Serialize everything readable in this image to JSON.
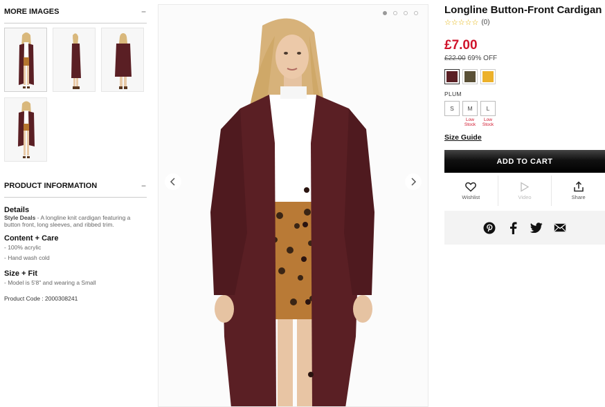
{
  "left": {
    "more_images_title": "MORE IMAGES",
    "more_images_toggle": "−",
    "product_info_title": "PRODUCT INFORMATION",
    "product_info_toggle": "−",
    "details_title": "Details",
    "details_lead": "Style Deals",
    "details_text": " - A longline knit cardigan featuring a button front, long sleeves, and ribbed trim.",
    "content_title": "Content + Care",
    "content_items": [
      "- 100% acrylic",
      "- Hand wash cold"
    ],
    "fit_title": "Size + Fit",
    "fit_items": [
      "- Model is 5'8\" and wearing a Small"
    ],
    "product_code": "Product Code : 2000308241"
  },
  "product": {
    "title": "Longline Button-Front Cardigan",
    "stars": "☆☆☆☆☆",
    "review_count": "(0)",
    "price": "£7.00",
    "original_price": "£22.00",
    "discount": "69% OFF",
    "colors": [
      {
        "name": "plum",
        "hex": "#5a1f24",
        "selected": true
      },
      {
        "name": "olive",
        "hex": "#5a5036",
        "selected": false
      },
      {
        "name": "mustard",
        "hex": "#ecb12b",
        "selected": false
      }
    ],
    "selected_color_label": "PLUM",
    "sizes": [
      {
        "label": "S",
        "note": ""
      },
      {
        "label": "M",
        "note": "Low Stock"
      },
      {
        "label": "L",
        "note": "Low Stock"
      }
    ],
    "size_guide": "Size Guide",
    "add_to_cart": "ADD TO CART",
    "actions": {
      "wishlist": "Wishlist",
      "video": "Video",
      "share": "Share"
    }
  },
  "gallery": {
    "dots": 4,
    "active_dot": 1,
    "icons": {
      "prev": "chevron-left-icon",
      "next": "chevron-right-icon"
    }
  },
  "social": [
    "pinterest-icon",
    "facebook-icon",
    "twitter-icon",
    "email-icon"
  ]
}
